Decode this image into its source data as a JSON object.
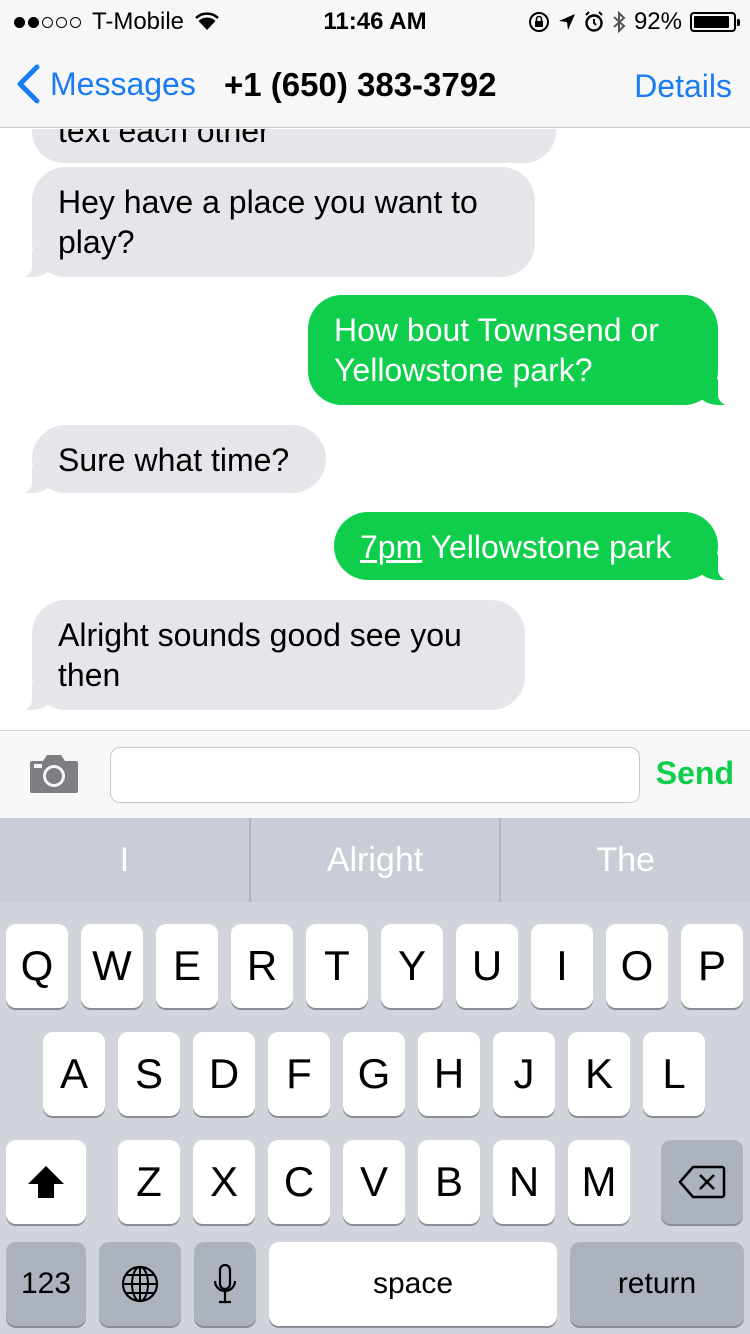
{
  "status_bar": {
    "carrier": "T-Mobile",
    "time": "11:46 AM",
    "battery": "92%",
    "battery_level": 0.92,
    "signal_dots": [
      true,
      true,
      false,
      false,
      false
    ],
    "icons": [
      "wifi-icon",
      "rotation-lock-icon",
      "location-icon",
      "alarm-icon",
      "bluetooth-icon",
      "battery-icon"
    ]
  },
  "nav": {
    "back_label": "Messages",
    "title": "+1 (650) 383-3792",
    "details_label": "Details"
  },
  "messages": [
    {
      "side": "in",
      "text": "text each other"
    },
    {
      "side": "in",
      "line1": "Hey have a place you want to",
      "line2": "play?"
    },
    {
      "side": "out",
      "line1": "How bout Townsend or",
      "line2": "Yellowstone  park?"
    },
    {
      "side": "in",
      "text": "Sure what time?"
    },
    {
      "side": "out",
      "link": "7pm",
      "text": " Yellowstone park"
    },
    {
      "side": "in",
      "line1": "Alright sounds good see you",
      "line2": "then"
    }
  ],
  "input": {
    "placeholder": "",
    "value": "",
    "send_label": "Send"
  },
  "predictive": [
    "I",
    "Alright",
    "The"
  ],
  "keyboard": {
    "row1": [
      "Q",
      "W",
      "E",
      "R",
      "T",
      "Y",
      "U",
      "I",
      "O",
      "P"
    ],
    "row2": [
      "A",
      "S",
      "D",
      "F",
      "G",
      "H",
      "J",
      "K",
      "L"
    ],
    "row3": [
      "Z",
      "X",
      "C",
      "V",
      "B",
      "N",
      "M"
    ],
    "numbers_label": "123",
    "space_label": "space",
    "return_label": "return"
  },
  "colors": {
    "accent_blue": "#1a7cf4",
    "sms_green": "#0ece4c",
    "incoming_gray": "#e5e5ea"
  }
}
